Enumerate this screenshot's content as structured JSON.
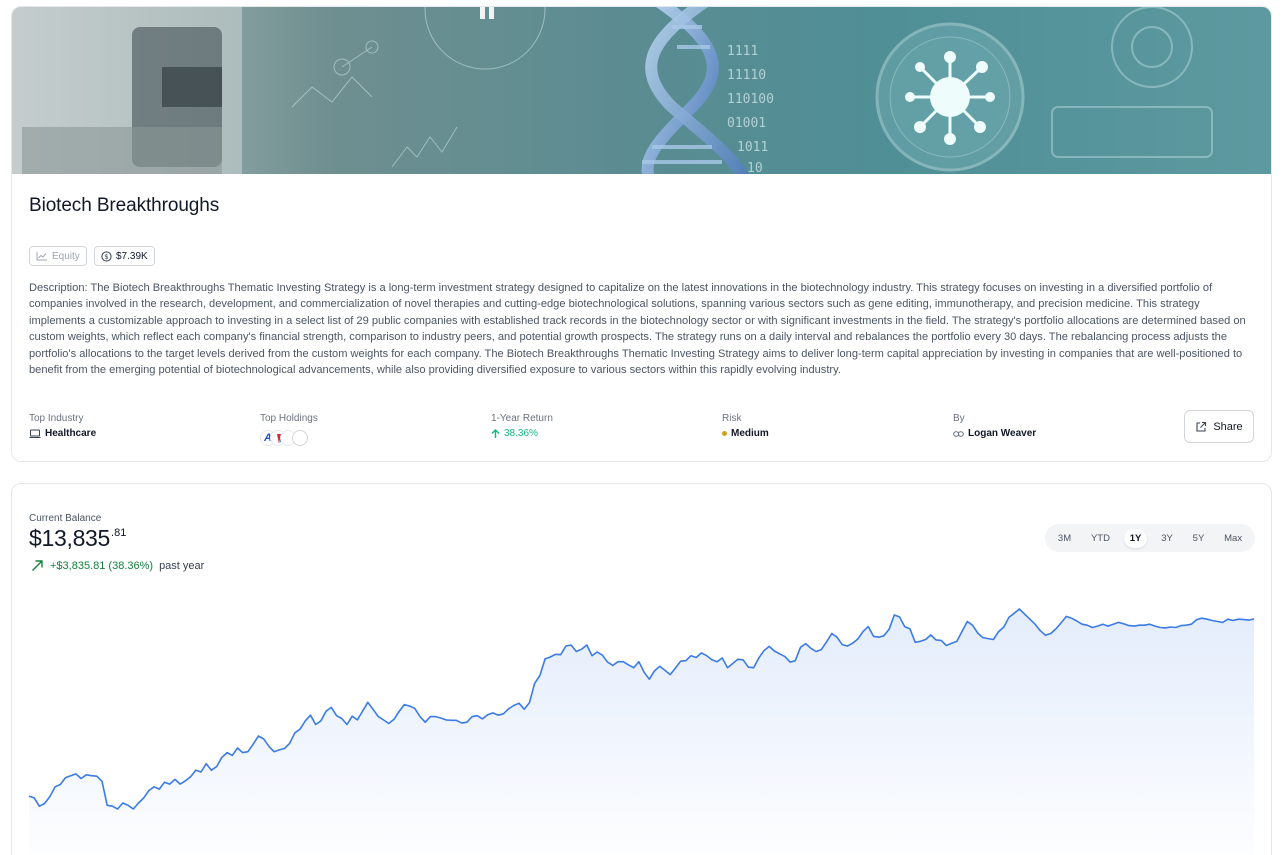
{
  "strategy": {
    "title": "Biotech Breakthroughs",
    "badges": {
      "type": "Equity",
      "value": "$7.39K"
    },
    "description": "Description: The Biotech Breakthroughs Thematic Investing Strategy is a long-term investment strategy designed to capitalize on the latest innovations in the biotechnology industry. This strategy focuses on investing in a diversified portfolio of companies involved in the research, development, and commercialization of novel therapies and cutting-edge biotechnological solutions, spanning various sectors such as gene editing, immunotherapy, and precision medicine. This strategy implements a customizable approach to investing in a select list of 29 public companies with established track records in the biotechnology sector or with significant investments in the field. The strategy's portfolio allocations are determined based on custom weights, which reflect each company's financial strength, comparison to industry peers, and potential growth prospects. The strategy runs on a daily interval and rebalances the portfolio every 30 days. The rebalancing process adjusts the portfolio's allocations to the target levels derived from the custom weights for each company. The Biotech Breakthroughs Thematic Investing Strategy aims to deliver long-term capital appreciation by investing in companies that are well-positioned to benefit from the emerging potential of biotechnological advancements, while also providing diversified exposure to various sectors within this rapidly evolving industry.",
    "stats": {
      "industry": {
        "label": "Top Industry",
        "value": "Healthcare"
      },
      "holdings": {
        "label": "Top Holdings"
      },
      "return": {
        "label": "1-Year Return",
        "value": "38.36%"
      },
      "risk": {
        "label": "Risk",
        "value": "Medium"
      },
      "author": {
        "label": "By",
        "value": "Logan Weaver"
      }
    },
    "share_label": "Share"
  },
  "balance": {
    "label": "Current Balance",
    "dollars": "$13,835",
    "cents": ".81",
    "change": "+$3,835.81 (38.36%)",
    "period": "past year"
  },
  "ranges": [
    "3M",
    "YTD",
    "1Y",
    "3Y",
    "5Y",
    "Max"
  ],
  "active_range": "1Y",
  "colors": {
    "line": "#3b7be8",
    "positive": "#15803d",
    "return": "#10b981",
    "risk_dot": "#d4a017"
  },
  "chart_data": {
    "type": "area",
    "title": "",
    "xlabel": "",
    "ylabel": "",
    "series": [
      {
        "values": [
          10000,
          9960,
          9780,
          9840,
          9990,
          10200,
          10250,
          10400,
          10440,
          10480,
          10380,
          10460,
          10440,
          10430,
          10320,
          9800,
          9780,
          9720,
          9850,
          9800,
          9720,
          9850,
          9960,
          10120,
          10200,
          10150,
          10300,
          10260,
          10360,
          10260,
          10330,
          10420,
          10560,
          10520,
          10700,
          10560,
          10640,
          10840,
          10940,
          10880,
          11040,
          10940,
          10960,
          11120,
          11300,
          11240,
          11080,
          10960,
          11000,
          11030,
          11140,
          11370,
          11450,
          11630,
          11750,
          11550,
          11630,
          11840,
          11920,
          11740,
          11680,
          11550,
          11730,
          11650,
          11840,
          12030,
          11880,
          11720,
          11650,
          11570,
          11660,
          11830,
          11980,
          11950,
          11900,
          11720,
          11600,
          11720,
          11720,
          11690,
          11650,
          11640,
          11640,
          11580,
          11600,
          11720,
          11740,
          11670,
          11760,
          11800,
          11750,
          11780,
          11890,
          11960,
          12010,
          11880,
          12020,
          12440,
          12610,
          12970,
          13010,
          13070,
          13060,
          13250,
          13270,
          13130,
          13180,
          13270,
          13040,
          13120,
          13050,
          12900,
          12830,
          12910,
          12910,
          12840,
          12780,
          12910,
          12680,
          12530,
          12710,
          12810,
          12720,
          12630,
          12770,
          12920,
          12930,
          13040,
          13000,
          13100,
          13040,
          12950,
          12910,
          12990,
          12780,
          12870,
          12960,
          12950,
          12790,
          12780,
          12990,
          13150,
          13240,
          13140,
          13080,
          13020,
          12900,
          12930,
          13220,
          13300,
          13200,
          13130,
          13170,
          13340,
          13520,
          13440,
          13280,
          13250,
          13310,
          13400,
          13560,
          13670,
          13460,
          13440,
          13470,
          13610,
          13920,
          13880,
          13670,
          13620,
          13330,
          13350,
          13390,
          13490,
          13380,
          13370,
          13260,
          13310,
          13350,
          13570,
          13780,
          13700,
          13530,
          13430,
          13410,
          13390,
          13560,
          13660,
          13870,
          13960,
          14050,
          13940,
          13830,
          13720,
          13580,
          13480,
          13520,
          13620,
          13750,
          13890,
          13850,
          13790,
          13720,
          13700,
          13650,
          13680,
          13720,
          13680,
          13720,
          13760,
          13730,
          13690,
          13680,
          13700,
          13700,
          13720,
          13680,
          13650,
          13640,
          13660,
          13650,
          13690,
          13700,
          13720,
          13820,
          13850,
          13830,
          13800,
          13780,
          13760,
          13830,
          13800,
          13830,
          13820,
          13810,
          13835.81
        ]
      }
    ]
  }
}
